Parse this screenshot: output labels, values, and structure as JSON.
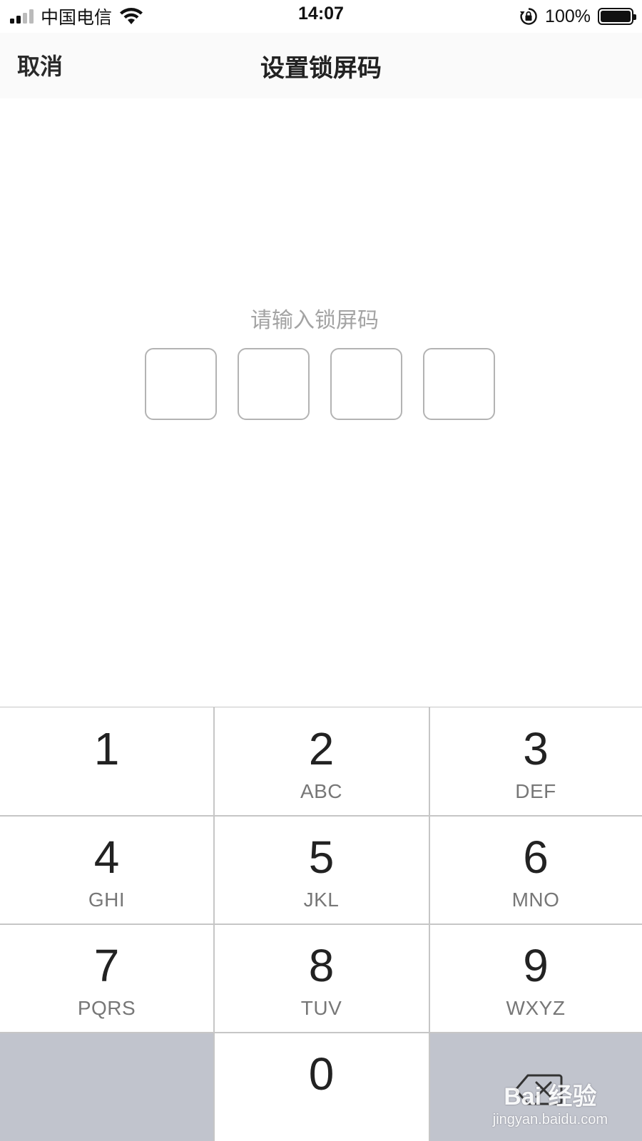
{
  "status_bar": {
    "carrier": "中国电信",
    "time": "14:07",
    "battery": "100%",
    "battery_level": 1.0
  },
  "nav": {
    "cancel": "取消",
    "title": "设置锁屏码"
  },
  "prompt": "请输入锁屏码",
  "code_length": 4,
  "keypad": {
    "keys": [
      {
        "digit": "1",
        "letters": ""
      },
      {
        "digit": "2",
        "letters": "ABC"
      },
      {
        "digit": "3",
        "letters": "DEF"
      },
      {
        "digit": "4",
        "letters": "GHI"
      },
      {
        "digit": "5",
        "letters": "JKL"
      },
      {
        "digit": "6",
        "letters": "MNO"
      },
      {
        "digit": "7",
        "letters": "PQRS"
      },
      {
        "digit": "8",
        "letters": "TUV"
      },
      {
        "digit": "9",
        "letters": "WXYZ"
      },
      {
        "digit": "0",
        "letters": ""
      }
    ],
    "colors": {
      "key_bg": "#ffffff",
      "function_key_bg": "#c1c4cd",
      "divider": "#c6c6c6"
    }
  },
  "icons": [
    "cellular-signal-icon",
    "wifi-icon",
    "rotation-lock-icon",
    "battery-icon",
    "backspace-icon"
  ],
  "watermark": {
    "logo": "Bai 经验",
    "url": "jingyan.baidu.com"
  }
}
